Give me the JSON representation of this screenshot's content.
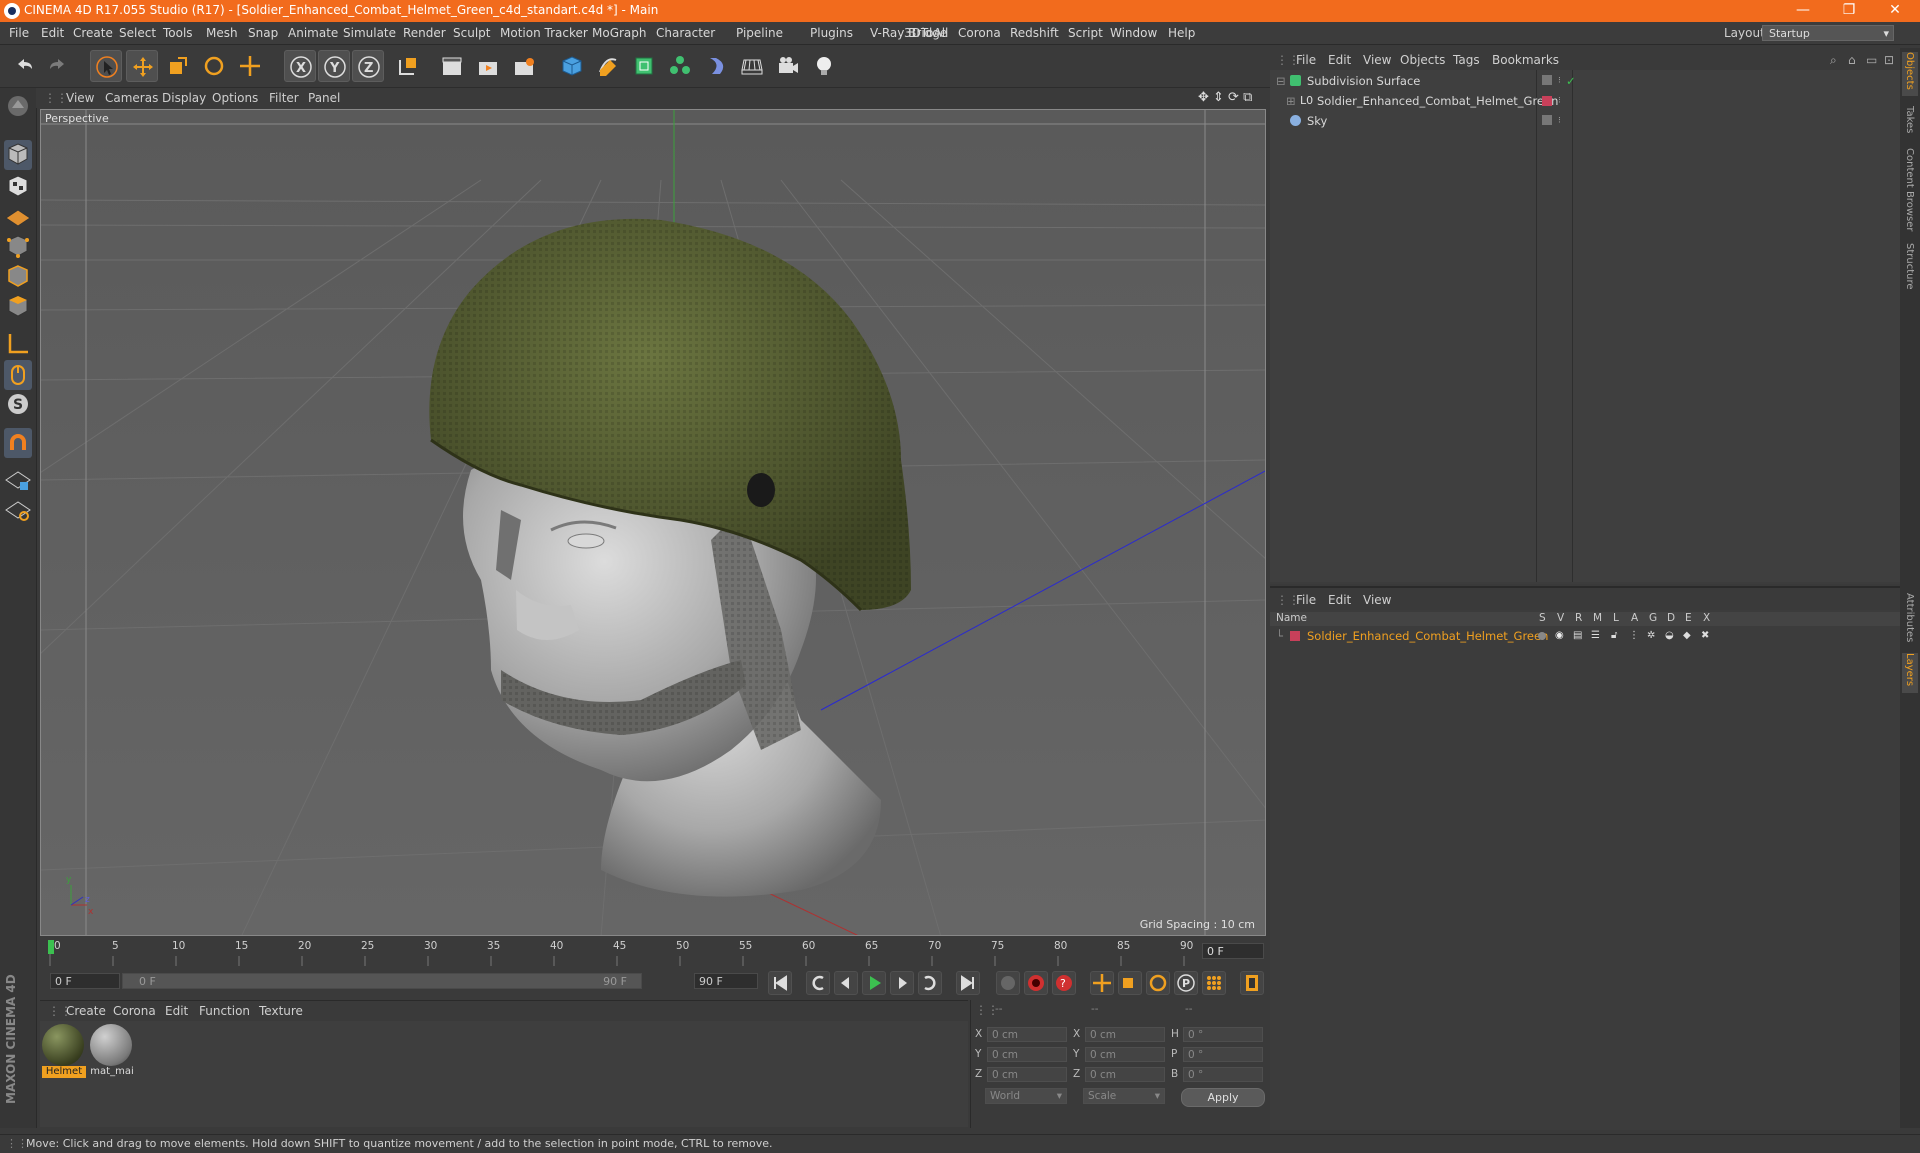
{
  "titlebar": {
    "title": "CINEMA 4D R17.055 Studio (R17) - [Soldier_Enhanced_Combat_Helmet_Green_c4d_standart.c4d *] - Main",
    "minimize": "—",
    "restore": "❐",
    "close": "✕"
  },
  "menubar": {
    "items": [
      "File",
      "Edit",
      "Create",
      "Select",
      "Tools",
      "Mesh",
      "Snap",
      "Animate",
      "Simulate",
      "Render",
      "Sculpt",
      "Motion Tracker",
      "MoGraph",
      "Character",
      "Pipeline",
      "Plugins",
      "V-Ray Bridge",
      "3DToAll",
      "Corona",
      "Redshift",
      "Script",
      "Window",
      "Help"
    ],
    "layout_label": "Layout:",
    "layout_value": "Startup"
  },
  "viewport": {
    "menu": [
      "View",
      "Cameras",
      "Display",
      "Options",
      "Filter",
      "Panel"
    ],
    "label": "Perspective",
    "grid_spacing": "Grid Spacing : 10 cm"
  },
  "timeline": {
    "ticks": [
      "0",
      "5",
      "10",
      "15",
      "20",
      "25",
      "30",
      "35",
      "40",
      "45",
      "50",
      "55",
      "60",
      "65",
      "70",
      "75",
      "80",
      "85",
      "90"
    ],
    "current_frame": "0 F",
    "start_field": "0 F",
    "range_start": "0 F",
    "range_end": "90 F",
    "end_field": "90 F"
  },
  "material_manager": {
    "menu": [
      "Create",
      "Corona",
      "Edit",
      "Function",
      "Texture"
    ],
    "materials": [
      {
        "name": "Helmet",
        "color": "#4a5230"
      },
      {
        "name": "mat_mai",
        "color": "#8a8a8a"
      }
    ]
  },
  "coordinates": {
    "header": [
      "--",
      "--",
      "--"
    ],
    "rows": [
      {
        "a": "X",
        "av": "0 cm",
        "b": "X",
        "bv": "0 cm",
        "c": "H",
        "cv": "0 °"
      },
      {
        "a": "Y",
        "av": "0 cm",
        "b": "Y",
        "bv": "0 cm",
        "c": "P",
        "cv": "0 °"
      },
      {
        "a": "Z",
        "av": "0 cm",
        "b": "Z",
        "bv": "0 cm",
        "c": "B",
        "cv": "0 °"
      }
    ],
    "world": "World",
    "scale": "Scale",
    "apply": "Apply"
  },
  "object_manager": {
    "menu": [
      "File",
      "Edit",
      "View",
      "Objects",
      "Tags",
      "Bookmarks"
    ],
    "objects": [
      {
        "name": "Subdivision Surface",
        "color": "#d8d8d8"
      },
      {
        "name": "Soldier_Enhanced_Combat_Helmet_Green",
        "color": "#d8d8d8"
      },
      {
        "name": "Sky",
        "color": "#d8d8d8"
      }
    ]
  },
  "layer_manager": {
    "menu": [
      "File",
      "Edit",
      "View"
    ],
    "columns": [
      "Name",
      "S",
      "V",
      "R",
      "M",
      "L",
      "A",
      "G",
      "D",
      "E",
      "X"
    ],
    "layers": [
      {
        "name": "Soldier_Enhanced_Combat_Helmet_Green",
        "color": "#f0a020"
      }
    ]
  },
  "right_tabs": [
    "Objects",
    "Takes",
    "Content Browser",
    "Structure",
    "Attributes",
    "Layers"
  ],
  "branding": "MAXON CINEMA 4D",
  "status": "Move: Click and drag to move elements. Hold down SHIFT to quantize movement / add to the selection in point mode, CTRL to remove.",
  "colors": {
    "accent": "#f26b1d",
    "selection": "#f0a020",
    "layer_red": "#c8405a"
  }
}
